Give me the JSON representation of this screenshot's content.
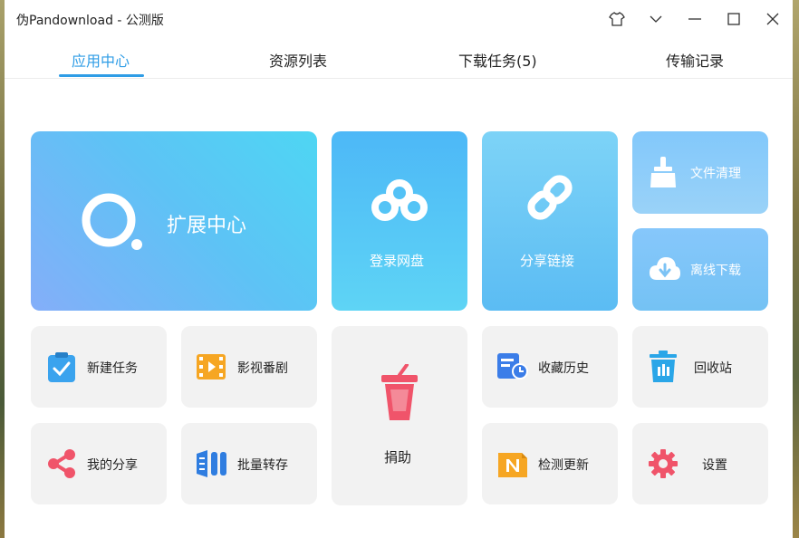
{
  "window": {
    "title": "伪Pandownload - 公测版",
    "controls": [
      "skin-icon",
      "chevron-down-icon",
      "minimize-icon",
      "maximize-icon",
      "close-icon"
    ]
  },
  "tabs": [
    {
      "label": "应用中心",
      "active": true
    },
    {
      "label": "资源列表",
      "active": false
    },
    {
      "label": "下载任务(5)",
      "active": false
    },
    {
      "label": "传输记录",
      "active": false
    }
  ],
  "tiles": {
    "extension_center": {
      "label": "扩展中心",
      "icon": "search-ring-icon"
    },
    "login_cloud": {
      "label": "登录网盘",
      "icon": "cloud-icon"
    },
    "share_link": {
      "label": "分享链接",
      "icon": "link-icon"
    },
    "file_cleanup": {
      "label": "文件清理",
      "icon": "broom-icon"
    },
    "offline_download": {
      "label": "离线下载",
      "icon": "cloud-download-icon"
    },
    "new_task": {
      "label": "新建任务",
      "icon": "clipboard-check-icon"
    },
    "movies_series": {
      "label": "影视番剧",
      "icon": "film-icon"
    },
    "donate": {
      "label": "捐助",
      "icon": "cup-icon"
    },
    "favorites_history": {
      "label": "收藏历史",
      "icon": "history-icon"
    },
    "recycle_bin": {
      "label": "回收站",
      "icon": "trash-icon"
    },
    "my_shares": {
      "label": "我的分享",
      "icon": "share-icon"
    },
    "batch_save": {
      "label": "批量转存",
      "icon": "batch-icon"
    },
    "check_update": {
      "label": "检测更新",
      "icon": "update-n-icon"
    },
    "settings": {
      "label": "设置",
      "icon": "gear-icon"
    }
  },
  "colors": {
    "accent": "#2f9de6",
    "tile_grey": "#f2f2f2"
  }
}
